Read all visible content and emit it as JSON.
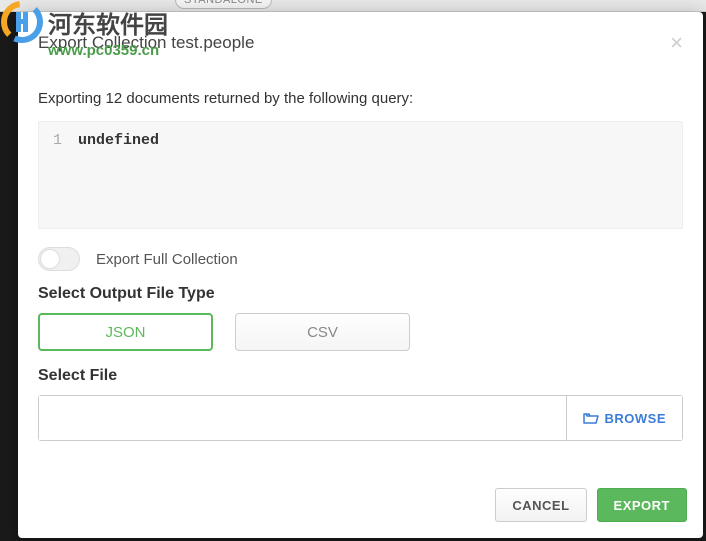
{
  "watermark": {
    "text": "河东软件园",
    "url": "www.pc0359.cn"
  },
  "background": {
    "tag": "STANDALONE"
  },
  "modal": {
    "title": "Export Collection test.people",
    "query_description": "Exporting 12 documents returned by the following query:",
    "code": {
      "line_number": "1",
      "content": "undefined"
    },
    "toggle": {
      "label": "Export Full Collection",
      "enabled": false
    },
    "file_type": {
      "label": "Select Output File Type",
      "options": {
        "json": "JSON",
        "csv": "CSV"
      },
      "selected": "json"
    },
    "file_select": {
      "label": "Select File",
      "value": "",
      "browse": "BROWSE"
    },
    "footer": {
      "cancel": "CANCEL",
      "export": "EXPORT"
    }
  }
}
